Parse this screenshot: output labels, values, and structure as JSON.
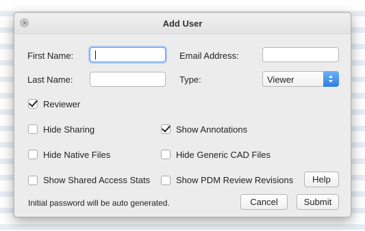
{
  "dialog": {
    "title": "Add User"
  },
  "form": {
    "first_name": {
      "label": "First Name:",
      "value": ""
    },
    "last_name": {
      "label": "Last Name:",
      "value": ""
    },
    "email": {
      "label": "Email Address:",
      "value": ""
    },
    "type": {
      "label": "Type:",
      "selected": "Viewer"
    }
  },
  "checkboxes": {
    "reviewer": {
      "label": "Reviewer",
      "checked": true
    },
    "hide_sharing": {
      "label": "Hide Sharing",
      "checked": false
    },
    "show_annotations": {
      "label": "Show Annotations",
      "checked": true
    },
    "hide_native_files": {
      "label": "Hide Native Files",
      "checked": false
    },
    "hide_generic_cad_files": {
      "label": "Hide Generic CAD Files",
      "checked": false
    },
    "show_shared_access_stats": {
      "label": "Show Shared Access Stats",
      "checked": false
    },
    "show_pdm_review_revisions": {
      "label": "Show PDM Review Revisions",
      "checked": false
    }
  },
  "buttons": {
    "help": "Help",
    "cancel": "Cancel",
    "submit": "Submit"
  },
  "note": "Initial password will be auto generated.",
  "colors": {
    "accent": "#2f7de1",
    "focus_ring": "#a9c8f2"
  }
}
